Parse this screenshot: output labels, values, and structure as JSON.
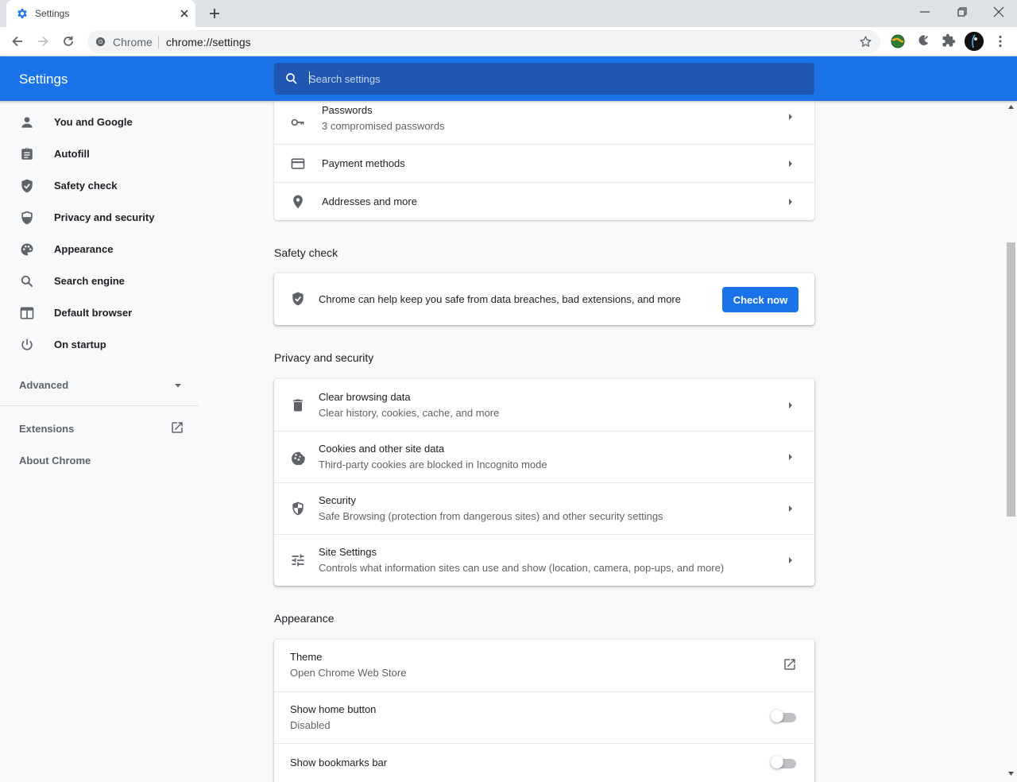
{
  "browser": {
    "tab_title": "Settings",
    "omnibox_chip": "Chrome",
    "url": "chrome://settings"
  },
  "header": {
    "title": "Settings",
    "search_placeholder": "Search settings"
  },
  "sidebar": {
    "items": [
      {
        "label": "You and Google",
        "icon": "person-icon"
      },
      {
        "label": "Autofill",
        "icon": "clipboard-icon"
      },
      {
        "label": "Safety check",
        "icon": "shield-check-icon"
      },
      {
        "label": "Privacy and security",
        "icon": "shield-icon"
      },
      {
        "label": "Appearance",
        "icon": "palette-icon"
      },
      {
        "label": "Search engine",
        "icon": "search-icon"
      },
      {
        "label": "Default browser",
        "icon": "browser-window-icon"
      },
      {
        "label": "On startup",
        "icon": "power-icon"
      }
    ],
    "advanced_label": "Advanced",
    "extensions_label": "Extensions",
    "about_label": "About Chrome"
  },
  "autofill": {
    "passwords_title": "Passwords",
    "passwords_sub": "3 compromised passwords",
    "payment_title": "Payment methods",
    "addresses_title": "Addresses and more"
  },
  "safety_check": {
    "heading": "Safety check",
    "description": "Chrome can help keep you safe from data breaches, bad extensions, and more",
    "button": "Check now"
  },
  "privacy": {
    "heading": "Privacy and security",
    "rows": [
      {
        "title": "Clear browsing data",
        "sub": "Clear history, cookies, cache, and more"
      },
      {
        "title": "Cookies and other site data",
        "sub": "Third-party cookies are blocked in Incognito mode"
      },
      {
        "title": "Security",
        "sub": "Safe Browsing (protection from dangerous sites) and other security settings"
      },
      {
        "title": "Site Settings",
        "sub": "Controls what information sites can use and show (location, camera, pop-ups, and more)"
      }
    ]
  },
  "appearance": {
    "heading": "Appearance",
    "theme_title": "Theme",
    "theme_sub": "Open Chrome Web Store",
    "home_title": "Show home button",
    "home_sub": "Disabled",
    "bookmarks_title": "Show bookmarks bar",
    "home_enabled": false,
    "bookmarks_enabled": false
  },
  "colors": {
    "accent": "#1a73e8",
    "header_search_bg": "#1f57b3",
    "page_bg": "#f8f9fa"
  }
}
